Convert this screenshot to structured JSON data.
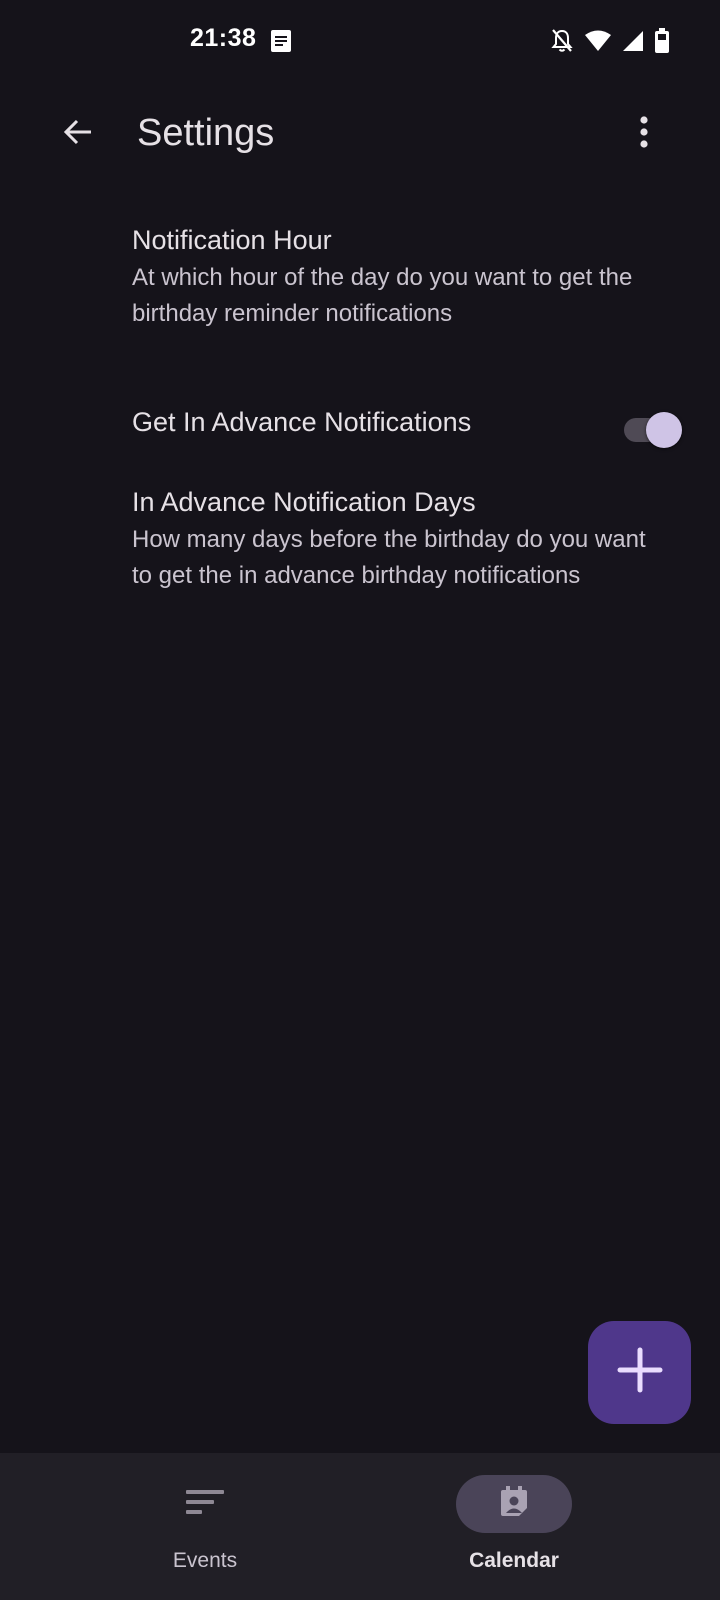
{
  "status_bar": {
    "time": "21:38",
    "icons": [
      "note-icon",
      "notifications-off-icon",
      "wifi-icon",
      "signal-icon",
      "battery-icon"
    ]
  },
  "app_bar": {
    "title": "Settings",
    "back_icon": "arrow-back-icon",
    "overflow_icon": "more-vert-icon"
  },
  "settings": {
    "notification_hour": {
      "title": "Notification Hour",
      "description": "At which hour of the day do you want to get the birthday reminder notifications"
    },
    "advance_notifications": {
      "title": "Get In Advance Notifications",
      "enabled": true
    },
    "advance_days": {
      "title": "In Advance Notification Days",
      "description": "How many days before the birthday do you want to get the in advance birthday notifications"
    }
  },
  "fab": {
    "icon": "add-icon"
  },
  "bottom_nav": {
    "items": [
      {
        "label": "Events",
        "icon": "sort-lines-icon",
        "selected": false
      },
      {
        "label": "Calendar",
        "icon": "calendar-person-icon",
        "selected": true
      }
    ]
  },
  "colors": {
    "background": "#15131a",
    "fab": "#4f378b",
    "toggle_thumb": "#cfc4e6",
    "nav_selected_indicator": "#4a4458",
    "nav_background": "#211f26"
  }
}
